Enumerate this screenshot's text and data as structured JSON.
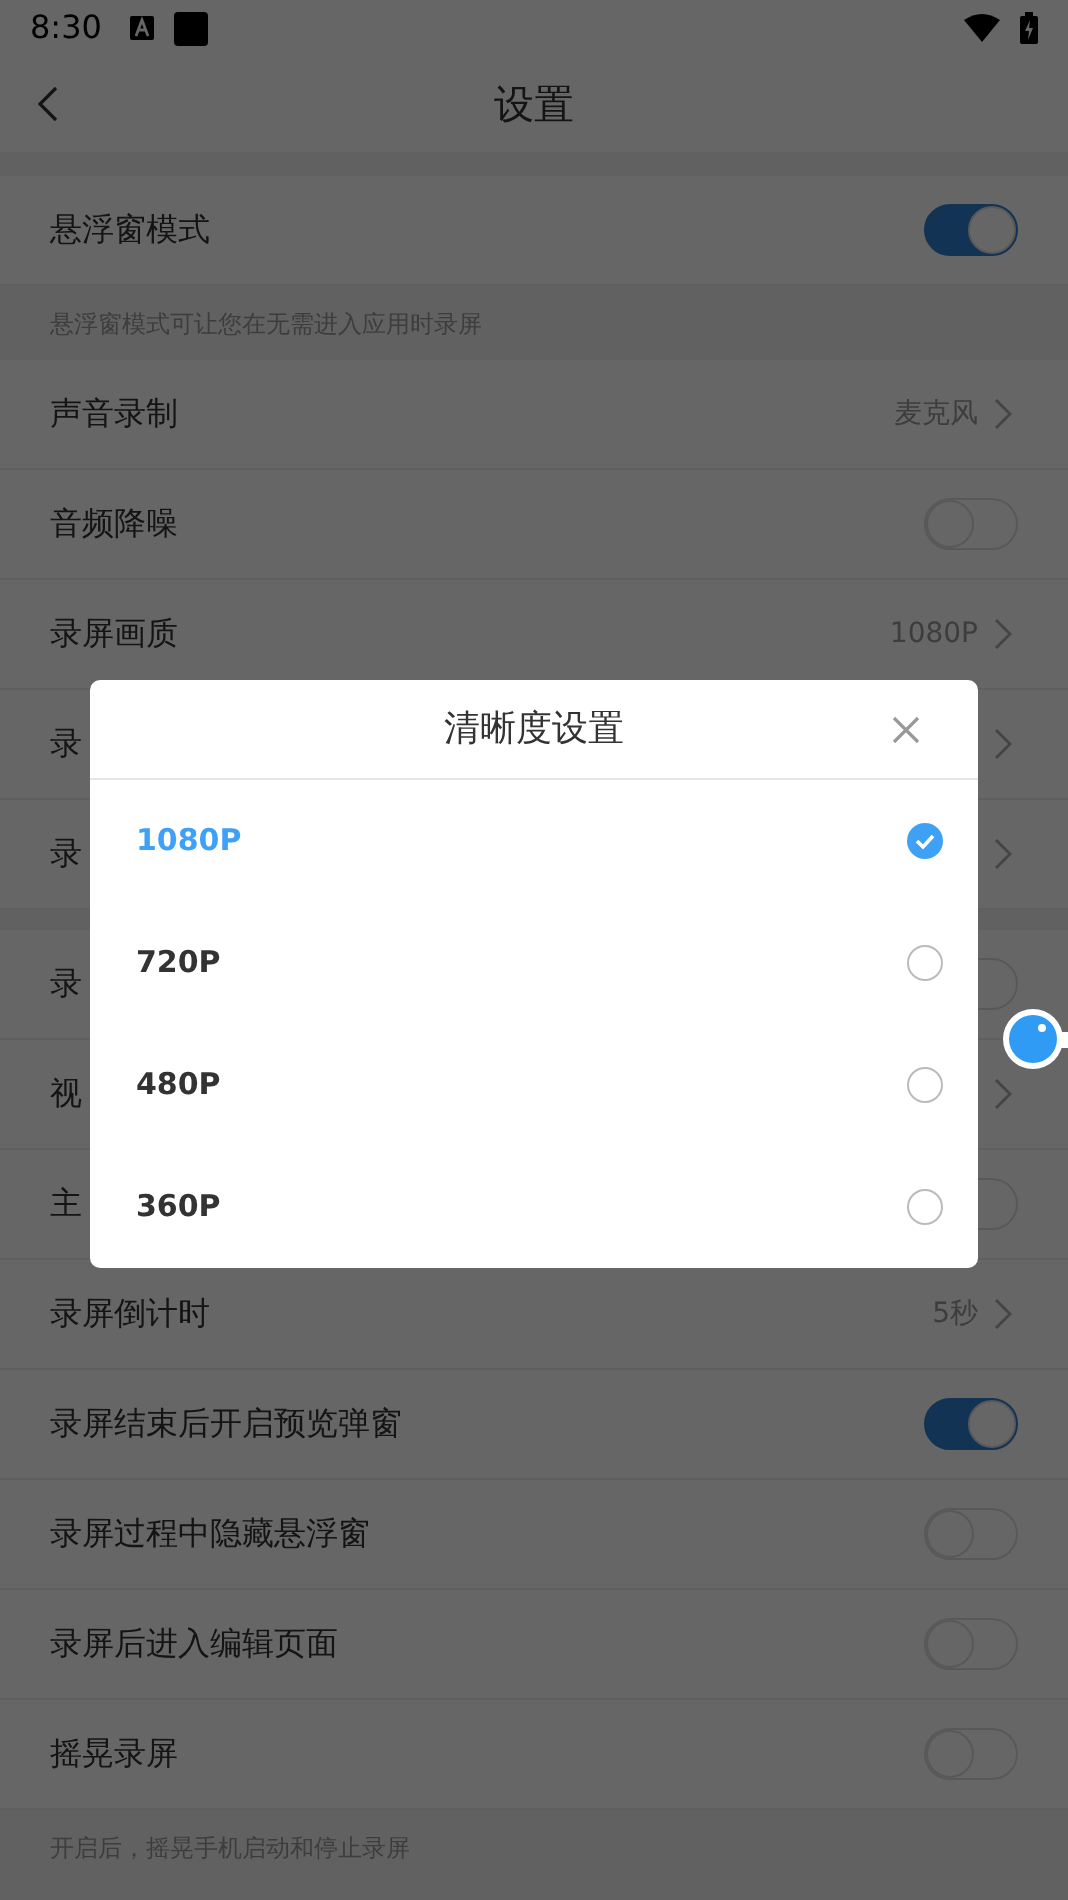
{
  "status_bar": {
    "time": "8:30"
  },
  "header": {
    "title": "设置"
  },
  "settings": [
    {
      "kind": "toggle",
      "label": "悬浮窗模式",
      "on": true
    },
    {
      "kind": "note",
      "text": "悬浮窗模式可让您在无需进入应用时录屏"
    },
    {
      "kind": "link",
      "label": "声音录制",
      "value": "麦克风"
    },
    {
      "kind": "toggle",
      "label": "音频降噪",
      "on": false
    },
    {
      "kind": "link",
      "label": "录屏画质",
      "value": "1080P"
    },
    {
      "kind": "link",
      "label": "录"
    },
    {
      "kind": "link",
      "label": "录"
    },
    {
      "kind": "gap"
    },
    {
      "kind": "toggle",
      "label": "录",
      "on": false
    },
    {
      "kind": "link",
      "label": "视"
    },
    {
      "kind": "toggle",
      "label": "主",
      "on": false
    },
    {
      "kind": "link",
      "label": "录屏倒计时",
      "value": "5秒"
    },
    {
      "kind": "toggle",
      "label": "录屏结束后开启预览弹窗",
      "on": true
    },
    {
      "kind": "toggle",
      "label": "录屏过程中隐藏悬浮窗",
      "on": false
    },
    {
      "kind": "toggle",
      "label": "录屏后进入编辑页面",
      "on": false
    },
    {
      "kind": "toggle",
      "label": "摇晃录屏",
      "on": false
    },
    {
      "kind": "note",
      "text": "开启后，摇晃手机启动和停止录屏"
    }
  ],
  "dialog": {
    "title": "清晰度设置",
    "options": [
      {
        "label": "1080P",
        "selected": true
      },
      {
        "label": "720P",
        "selected": false
      },
      {
        "label": "480P",
        "selected": false
      },
      {
        "label": "360P",
        "selected": false
      }
    ]
  }
}
